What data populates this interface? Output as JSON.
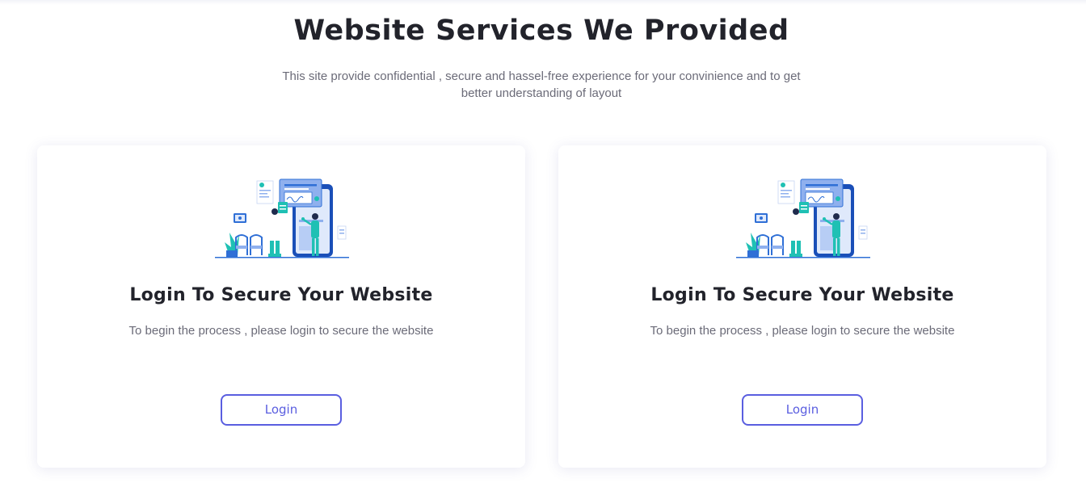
{
  "header": {
    "title": "Website Services We Provided",
    "subtitle": "This site provide confidential , secure and hassel-free experience for your convinience and to get better understanding of layout"
  },
  "cards": [
    {
      "illustration": "secure-login-illustration",
      "title": "Login To Secure Your Website",
      "description": "To begin the process , please login to secure the website",
      "button_label": "Login"
    },
    {
      "illustration": "secure-login-illustration",
      "title": "Login To Secure Your Website",
      "description": "To begin the process , please login to secure the website",
      "button_label": "Login"
    }
  ],
  "colors": {
    "accent": "#5a5ee0",
    "heading": "#22232b",
    "body_text": "#6b6b78",
    "illustration_blue": "#2f6fd6",
    "illustration_teal": "#1fc0b4"
  }
}
